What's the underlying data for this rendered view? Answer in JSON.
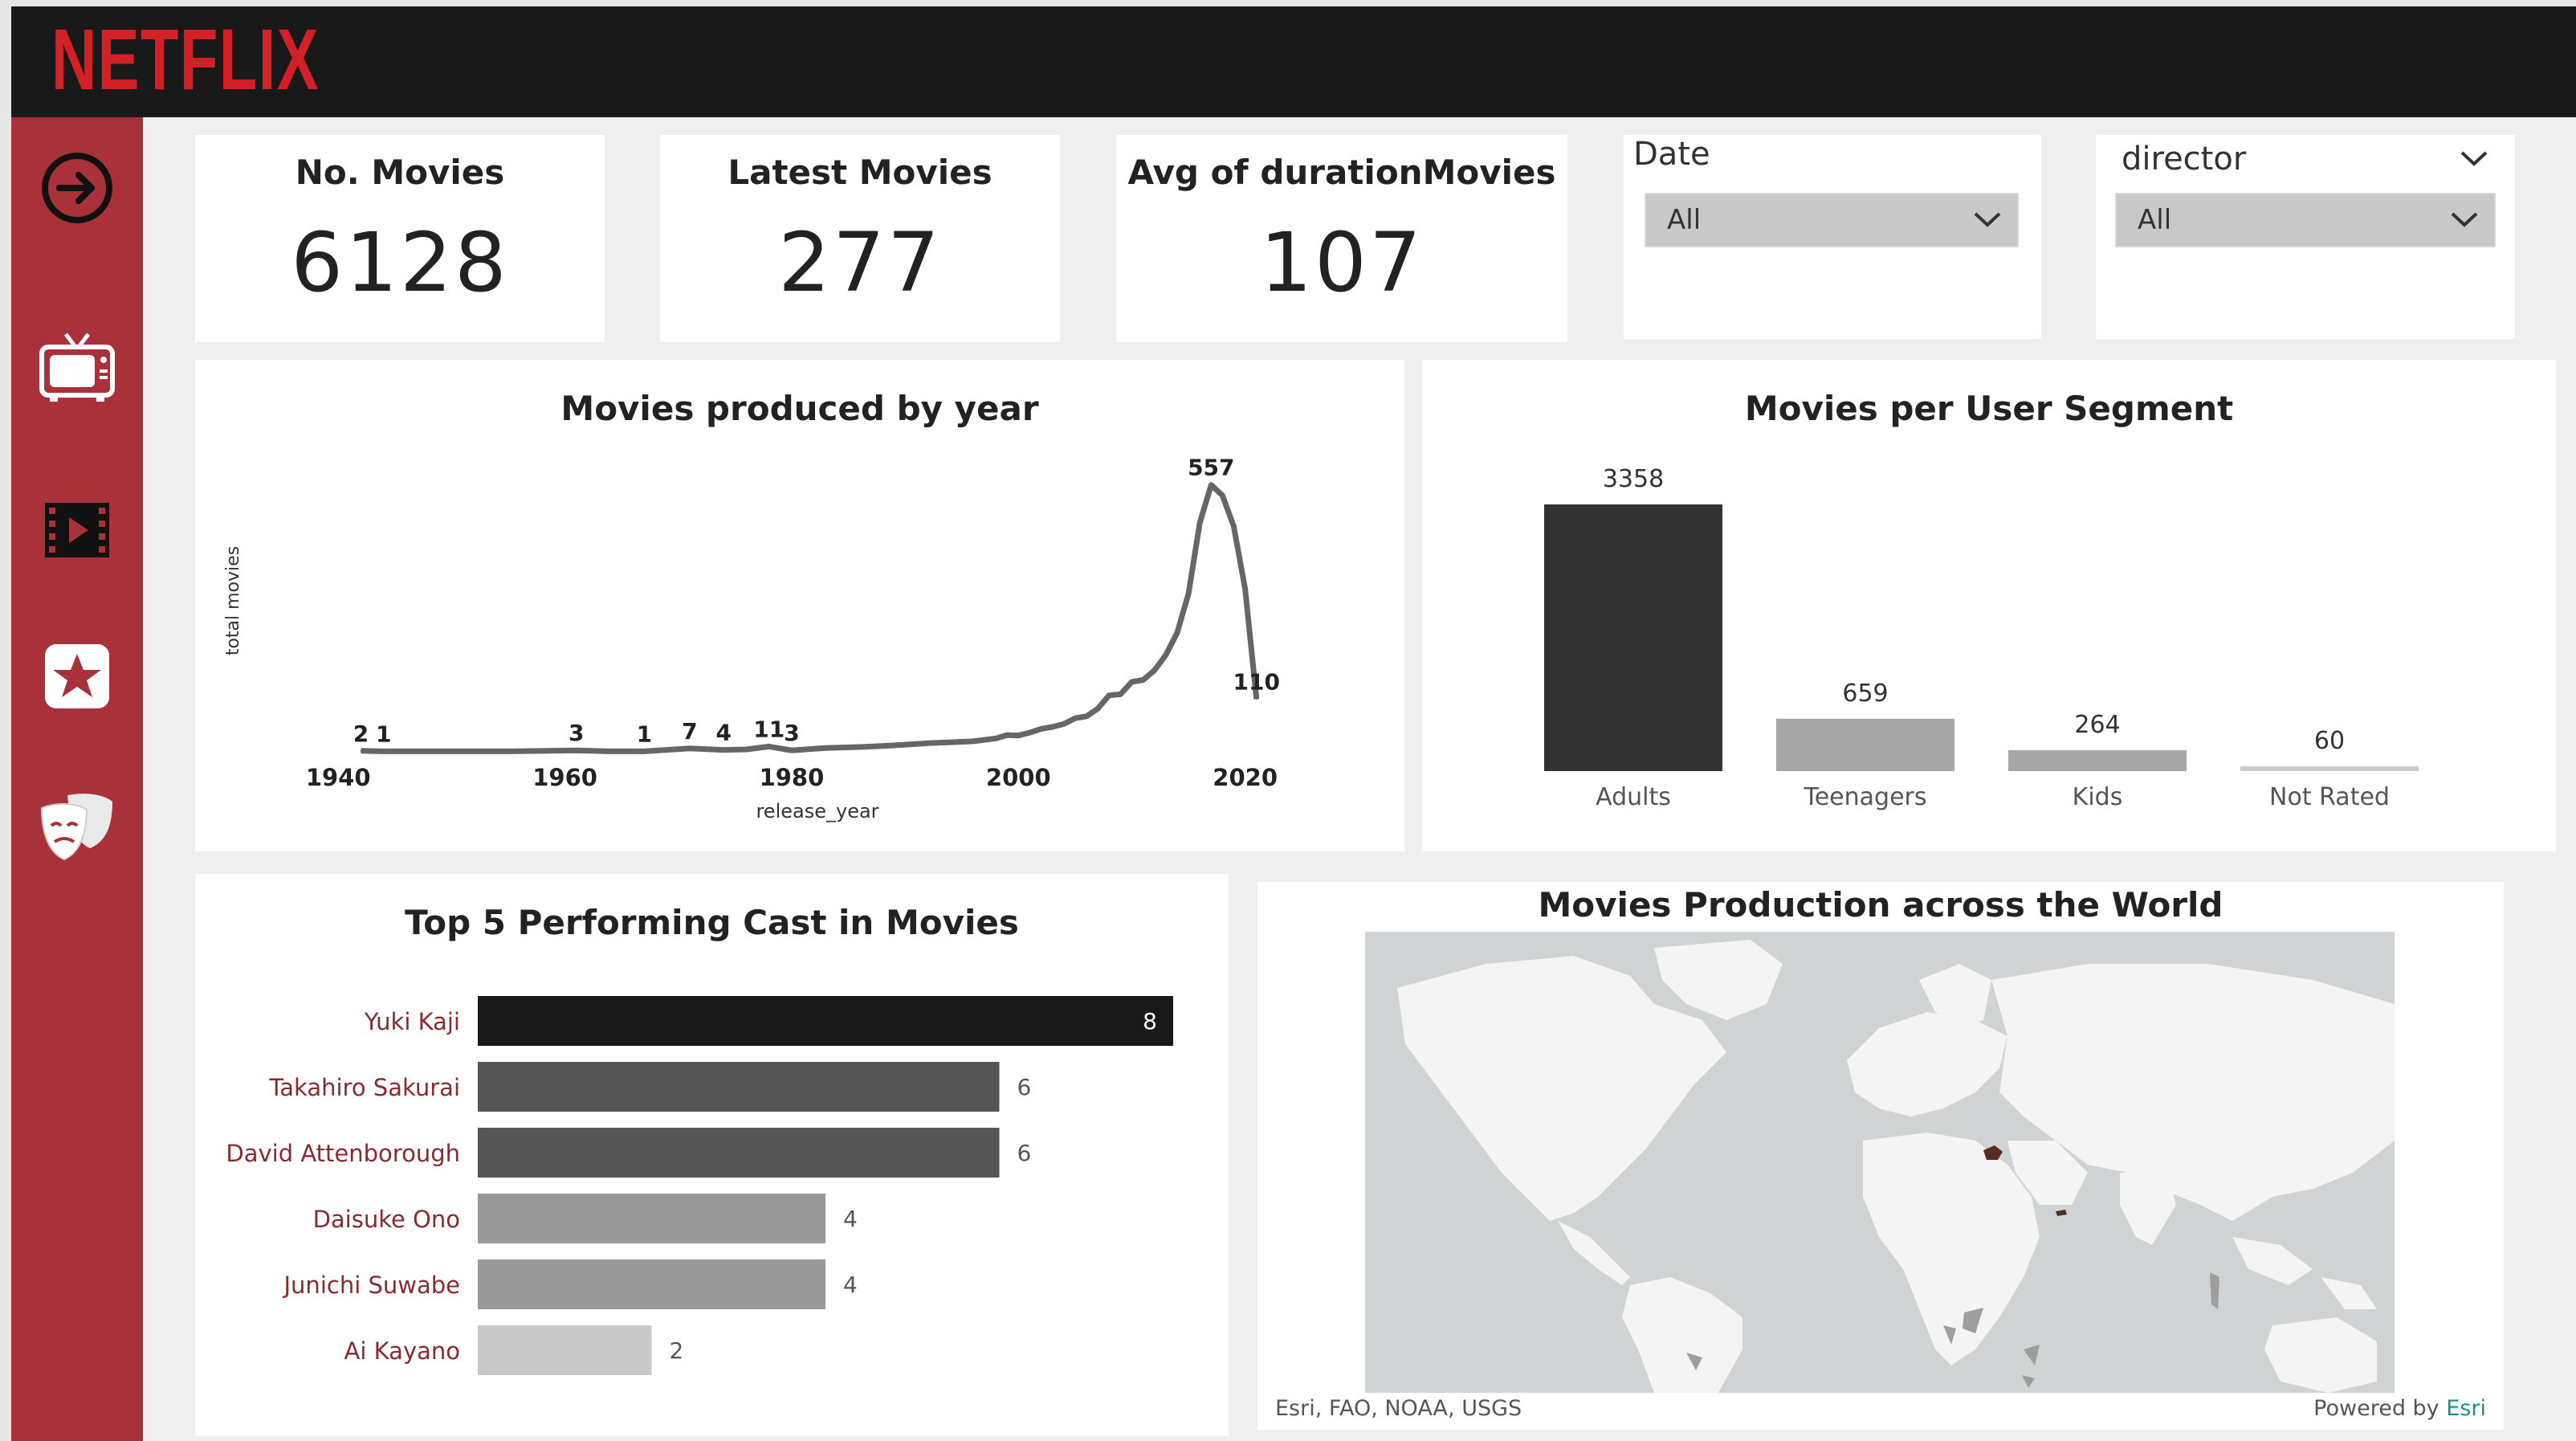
{
  "app": {
    "logo": "NETFLIX"
  },
  "sidebar": {
    "icons": [
      "arrow-right-circle-icon",
      "tv-icon",
      "film-icon",
      "star-icon",
      "theater-masks-icon"
    ]
  },
  "kpis": [
    {
      "title": "No. Movies",
      "value": "6128"
    },
    {
      "title": "Latest Movies",
      "value": "277"
    },
    {
      "title": "Avg of durationMovies",
      "value": "107"
    }
  ],
  "slicers": {
    "date": {
      "label": "Date",
      "value": "All"
    },
    "director": {
      "label": "director",
      "value": "All"
    }
  },
  "colors": {
    "brand_red": "#d31f26",
    "sidebar": "#a8313a",
    "topbar": "#1a1919"
  },
  "chart_data": [
    {
      "type": "line",
      "title": "Movies produced by year",
      "xlabel": "release_year",
      "ylabel": "total movies",
      "x_ticks": [
        "1940",
        "1960",
        "1980",
        "2000",
        "2020"
      ],
      "xlim": [
        1938,
        2023
      ],
      "ylim": [
        0,
        600
      ],
      "points": [
        [
          1942,
          2
        ],
        [
          1944,
          1
        ],
        [
          1946,
          1
        ],
        [
          1950,
          1
        ],
        [
          1955,
          1
        ],
        [
          1961,
          3
        ],
        [
          1964,
          1
        ],
        [
          1967,
          1
        ],
        [
          1971,
          7
        ],
        [
          1974,
          4
        ],
        [
          1976,
          5
        ],
        [
          1978,
          11
        ],
        [
          1980,
          3
        ],
        [
          1983,
          8
        ],
        [
          1986,
          10
        ],
        [
          1988,
          12
        ],
        [
          1990,
          15
        ],
        [
          1992,
          18
        ],
        [
          1994,
          20
        ],
        [
          1996,
          22
        ],
        [
          1998,
          28
        ],
        [
          1999,
          35
        ],
        [
          2000,
          34
        ],
        [
          2001,
          40
        ],
        [
          2002,
          48
        ],
        [
          2003,
          52
        ],
        [
          2004,
          58
        ],
        [
          2005,
          70
        ],
        [
          2006,
          74
        ],
        [
          2007,
          90
        ],
        [
          2008,
          118
        ],
        [
          2009,
          120
        ],
        [
          2010,
          146
        ],
        [
          2011,
          150
        ],
        [
          2012,
          170
        ],
        [
          2013,
          202
        ],
        [
          2014,
          248
        ],
        [
          2015,
          330
        ],
        [
          2016,
          478
        ],
        [
          2017,
          557
        ],
        [
          2018,
          535
        ],
        [
          2019,
          470
        ],
        [
          2020,
          340
        ],
        [
          2021,
          110
        ]
      ],
      "labels": [
        {
          "x": 1942,
          "y": 2,
          "text": "2"
        },
        {
          "x": 1944,
          "y": 1,
          "text": "1"
        },
        {
          "x": 1961,
          "y": 3,
          "text": "3"
        },
        {
          "x": 1967,
          "y": 1,
          "text": "1"
        },
        {
          "x": 1971,
          "y": 7,
          "text": "7"
        },
        {
          "x": 1974,
          "y": 4,
          "text": "4"
        },
        {
          "x": 1978,
          "y": 11,
          "text": "11"
        },
        {
          "x": 1980,
          "y": 3,
          "text": "3"
        },
        {
          "x": 2017,
          "y": 557,
          "text": "557"
        },
        {
          "x": 2021,
          "y": 110,
          "text": "110"
        }
      ]
    },
    {
      "type": "bar",
      "title": "Movies per User Segment",
      "categories": [
        "Adults",
        "Teenagers",
        "Kids",
        "Not Rated"
      ],
      "values": [
        3358,
        659,
        264,
        60
      ],
      "colors": [
        "#333333",
        "#a6a6a6",
        "#a6a6a6",
        "#c9c9c9"
      ],
      "ylim": [
        0,
        3358
      ]
    },
    {
      "type": "bar",
      "orientation": "horizontal",
      "title": "Top 5 Performing Cast in Movies",
      "categories": [
        "Yuki Kaji",
        "Takahiro Sakurai",
        "David Attenborough",
        "Daisuke Ono",
        "Junichi Suwabe",
        "Ai Kayano"
      ],
      "values": [
        8,
        6,
        6,
        4,
        4,
        2
      ],
      "colors": [
        "#1a1a1a",
        "#555555",
        "#555555",
        "#999999",
        "#999999",
        "#c8c8c8"
      ],
      "xlim": [
        0,
        8
      ]
    }
  ],
  "map": {
    "title": "Movies Production across the World",
    "attribution": "Esri, FAO, NOAA, USGS",
    "powered_by": "Powered by",
    "powered_by_link": "Esri"
  }
}
